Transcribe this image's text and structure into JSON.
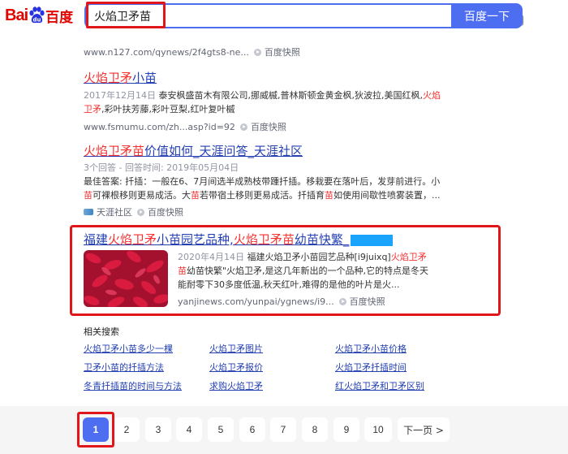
{
  "header": {
    "logo_text": "Bai",
    "logo_cn": "百度",
    "query": "火焰卫矛苗",
    "search_button": "百度一下"
  },
  "results": [
    {
      "url": "www.n127.com/qynews/2f4gts8-ne...",
      "snapshot": "百度快照"
    },
    {
      "title_em": "火焰卫矛",
      "title_rest": "小苗",
      "date": "2017年12月14日",
      "abstract_1": "泰安枫盛苗木有限公司,挪威槭,普林斯顿金黄金枫,狄波拉,美国红枫,",
      "abstract_em": "火焰卫矛",
      "abstract_2": ",彩叶扶芳藤,彩叶豆梨,红叶复叶槭",
      "url": "www.fsmumu.com/zh...asp?id=92",
      "snapshot": "百度快照"
    },
    {
      "title_em": "火焰卫矛苗",
      "title_rest": "价值如何_天涯问答_天涯社区",
      "meta": "3个回答 - 回答时间: 2019年05月04日",
      "abstract_a": "最佳答案: 扦插：一般在6、7月间选半成熟枝带踵扦插。移栽要在落叶后，发芽前进行。小",
      "abstract_em1": "苗",
      "abstract_b": "可裸根移则更易成活。大",
      "abstract_em2": "苗",
      "abstract_c": "若带宿土移则更易成活。扦插育",
      "abstract_em3": "苗",
      "abstract_d": "如使用间歇性喷雾装置，...",
      "site": "天涯社区",
      "snapshot": "百度快照"
    },
    {
      "title_1": "福建",
      "title_em1": "火焰卫矛",
      "title_2": "小苗园艺品种,",
      "title_em2": "火焰卫矛苗",
      "title_3": "幼苗快繁_",
      "date": "2020年4月14日",
      "abstract_a": "福建火焰卫矛小苗园艺品种[i9juixq]",
      "abstract_em": "火焰卫矛苗",
      "abstract_b": "幼苗快繁\"火焰卫矛,是这几年新出的一个品种,它的特点是冬天能耐零下30多度低温,秋天红叶,难得的是他的叶片是火...",
      "url": "yanjinews.com/yunpai/ygnews/i9...",
      "snapshot": "百度快照"
    }
  ],
  "related": {
    "heading": "相关搜索",
    "items": [
      "火焰卫矛小苗多少一棵",
      "火焰卫矛图片",
      "火焰卫矛小苗价格",
      "卫矛小苗的扦插方法",
      "火焰卫矛报价",
      "火焰卫矛扦插时间",
      "冬青扦插苗的时间与方法",
      "求购火焰卫矛",
      "红火焰卫矛和卫矛区别"
    ]
  },
  "pager": {
    "pages": [
      "1",
      "2",
      "3",
      "4",
      "5",
      "6",
      "7",
      "8",
      "9",
      "10"
    ],
    "current": "1",
    "next": "下一页 >"
  },
  "colors": {
    "brand_blue": "#4e6ef2",
    "link_blue": "#2440b3",
    "highlight_red": "#f73131",
    "annotation_red": "#e0161b"
  }
}
